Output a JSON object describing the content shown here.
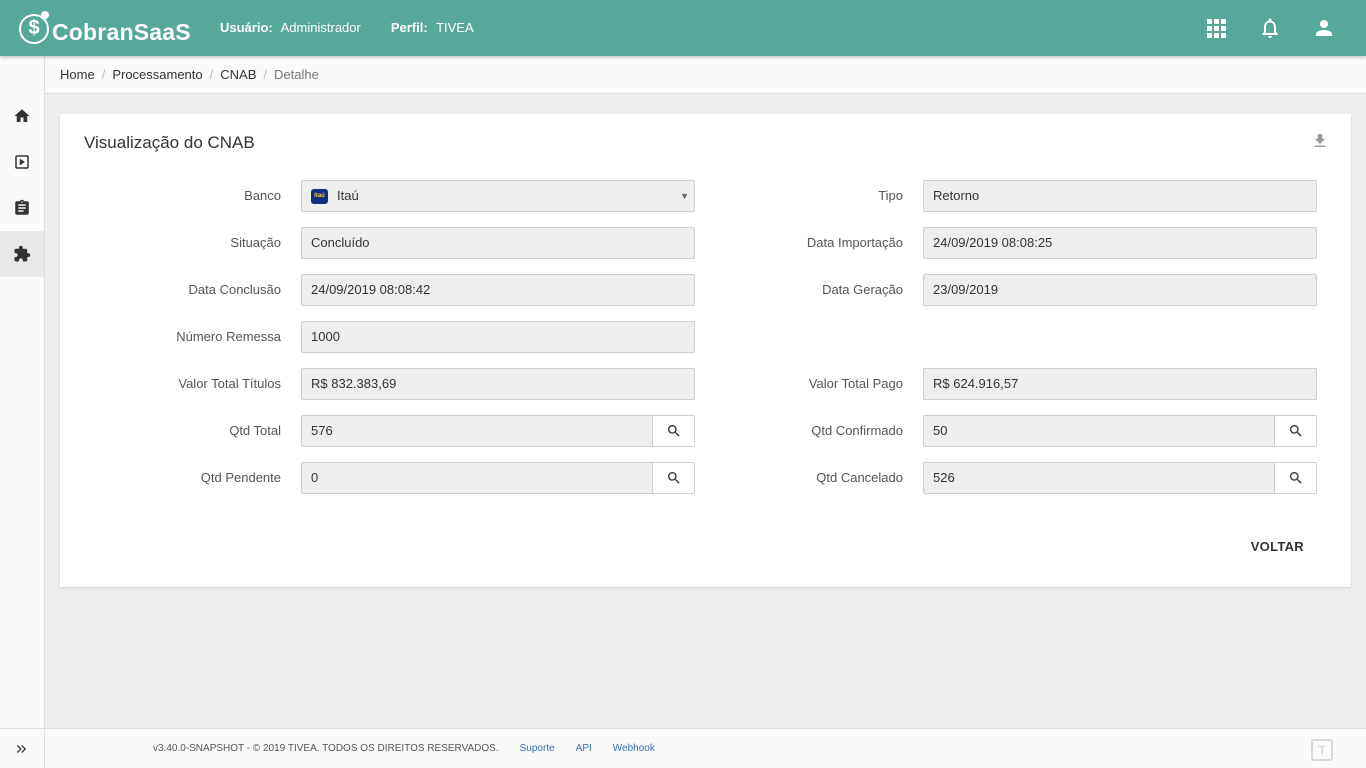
{
  "app": {
    "logo_text": "CobranSaaS"
  },
  "header": {
    "user_label": "Usuário:",
    "user_value": "Administrador",
    "profile_label": "Perfil:",
    "profile_value": "TIVEA",
    "icons": [
      "apps-grid-icon",
      "bell-icon",
      "user-icon"
    ]
  },
  "sidebar": {
    "items": [
      "home-icon",
      "play-box-icon",
      "clipboard-icon",
      "puzzle-icon"
    ],
    "active": "puzzle-icon"
  },
  "breadcrumb": [
    "Home",
    "Processamento",
    "CNAB",
    "Detalhe"
  ],
  "card": {
    "title": "Visualização do CNAB"
  },
  "form": {
    "banco": {
      "label": "Banco",
      "value": "Itaú",
      "logo_text": "Itaú"
    },
    "tipo": {
      "label": "Tipo",
      "value": "Retorno"
    },
    "situacao": {
      "label": "Situação",
      "value": "Concluído"
    },
    "data_importacao": {
      "label": "Data Importação",
      "value": "24/09/2019 08:08:25"
    },
    "data_conclusao": {
      "label": "Data Conclusão",
      "value": "24/09/2019 08:08:42"
    },
    "data_geracao": {
      "label": "Data Geração",
      "value": "23/09/2019"
    },
    "numero_remessa": {
      "label": "Número Remessa",
      "value": "1000"
    },
    "valor_total_titulos": {
      "label": "Valor Total Títulos",
      "value": "R$ 832.383,69"
    },
    "valor_total_pago": {
      "label": "Valor Total Pago",
      "value": "R$ 624.916,57"
    },
    "qtd_total": {
      "label": "Qtd Total",
      "value": "576"
    },
    "qtd_confirmado": {
      "label": "Qtd Confirmado",
      "value": "50"
    },
    "qtd_pendente": {
      "label": "Qtd Pendente",
      "value": "0"
    },
    "qtd_cancelado": {
      "label": "Qtd Cancelado",
      "value": "526"
    }
  },
  "actions": {
    "voltar_label": "VOLTAR"
  },
  "footer": {
    "copyright": "v3.40.0-SNAPSHOT - © 2019 TIVEA. TODOS OS DIREITOS RESERVADOS.",
    "links": [
      "Suporte",
      "API",
      "Webhook"
    ],
    "logo_text": "T"
  },
  "colors": {
    "header": "#55a89a",
    "link": "#3b6fb6",
    "field_bg": "#eeeeee"
  }
}
